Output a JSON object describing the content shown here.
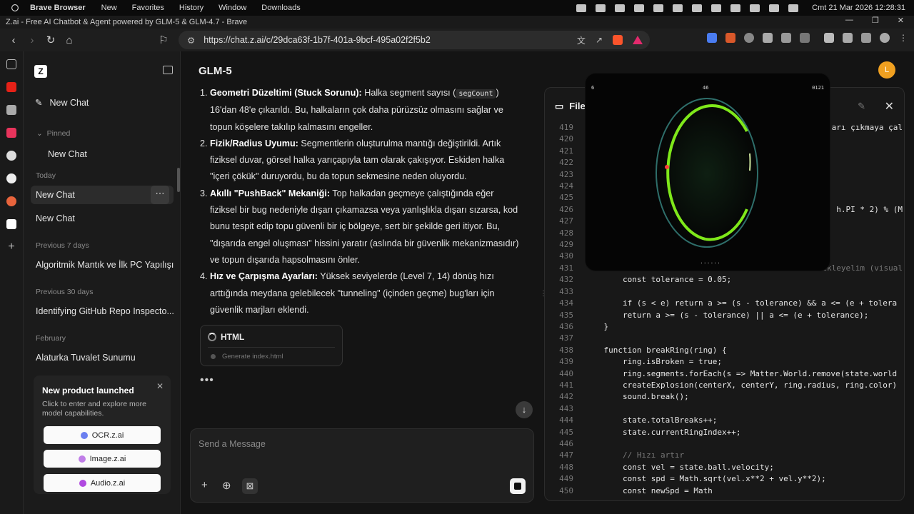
{
  "menubar": {
    "app": "Brave Browser",
    "items": [
      "New",
      "Favorites",
      "History",
      "Window",
      "Downloads"
    ],
    "clock": "Cmt 21 Mar 2026 12:28:31"
  },
  "window": {
    "title": "Z.ai - Free AI Chatbot & Agent powered by GLM-5 & GLM-4.7 - Brave"
  },
  "browser": {
    "url": "https://chat.z.ai/c/29dca63f-1b7f-401a-9bcf-495a02f2f5b2",
    "shield_count": "12"
  },
  "sidebar": {
    "new_chat": "New Chat",
    "pinned_label": "Pinned",
    "pinned_item": "New Chat",
    "today_label": "Today",
    "today_items": [
      "New Chat",
      "New Chat"
    ],
    "prev7_label": "Previous 7 days",
    "prev7_item": "Algoritmik Mantık ve İlk PC Yapılışı",
    "prev30_label": "Previous 30 days",
    "prev30_item": "Identifying GitHub Repo Inspecto...",
    "feb_label": "February",
    "feb_item": "Alaturka Tuvalet Sunumu",
    "promo": {
      "title": "New product launched",
      "desc": "Click to enter and explore more model capabilities.",
      "buttons": [
        "OCR.z.ai",
        "Image.z.ai",
        "Audio.z.ai"
      ]
    }
  },
  "chat": {
    "model": "GLM-5",
    "items": [
      {
        "title": "Geometri Düzeltimi (Stuck Sorunu):",
        "pre": " Halka segment sayısı (",
        "code": "segCount",
        "post": ") 16'dan 48'e çıkarıldı. Bu, halkaların çok daha pürüzsüz olmasını sağlar ve topun köşelere takılıp kalmasını engeller."
      },
      {
        "title": "Fizik/Radius Uyumu:",
        "text": " Segmentlerin oluşturulma mantığı değiştirildi. Artık fiziksel duvar, görsel halka yarıçapıyla tam olarak çakışıyor. Eskiden halka \"içeri çökük\" duruyordu, bu da topun sekmesine neden oluyordu."
      },
      {
        "title": "Akıllı \"PushBack\" Mekaniği:",
        "text": " Top halkadan geçmeye çalıştığında eğer fiziksel bir bug nedeniyle dışarı çıkamazsa veya yanlışlıkla dışarı sızarsa, kod bunu tespit edip topu güvenli bir iç bölgeye, sert bir şekilde geri itiyor. Bu, \"dışarıda engel oluşması\" hissini yaratır (aslında bir güvenlik mekanizmasıdır) ve topun dışarıda hapsolmasını önler."
      },
      {
        "title": "Hız ve Çarpışma Ayarları:",
        "text": " Yüksek seviyelerde (Level 7, 14) dönüş hızı arttığında meydana gelebilecek \"tunneling\" (içinden geçme) bug'ları için güvenlik marjları eklendi."
      }
    ],
    "artifact": {
      "title": "HTML",
      "step": "Generate index.html"
    },
    "composer_placeholder": "Send a Message",
    "avatar": "L"
  },
  "panel": {
    "title": "File"
  },
  "game": {
    "hud_left": "6",
    "hud_center": "46",
    "hud_right": "0121"
  },
  "code_lines": [
    {
      "n": 419,
      "t": ""
    },
    {
      "n": 420,
      "t": ""
    },
    {
      "n": 421,
      "t": ""
    },
    {
      "n": 422,
      "t": ""
    },
    {
      "n": 423,
      "t": ""
    },
    {
      "n": 424,
      "t": ""
    },
    {
      "n": 425,
      "t": ""
    },
    {
      "n": 426,
      "t": ""
    },
    {
      "n": 427,
      "t": ""
    },
    {
      "n": 428,
      "t": ""
    },
    {
      "n": 429,
      "t": ""
    },
    {
      "n": 430,
      "t": ""
    },
    {
      "n": 431,
      "t": ""
    },
    {
      "n": 432,
      "t": "        const tolerance = 0.05;"
    },
    {
      "n": 433,
      "t": ""
    },
    {
      "n": 434,
      "t": "        if (s < e) return a >= (s - tolerance) && a <= (e + tolera"
    },
    {
      "n": 435,
      "t": "        return a >= (s - tolerance) || a <= (e + tolerance);"
    },
    {
      "n": 436,
      "t": "    }"
    },
    {
      "n": 437,
      "t": ""
    },
    {
      "n": 438,
      "t": "    function breakRing(ring) {"
    },
    {
      "n": 439,
      "t": "        ring.isBroken = true;"
    },
    {
      "n": 440,
      "t": "        ring.segments.forEach(s => Matter.World.remove(state.world"
    },
    {
      "n": 441,
      "t": "        createExplosion(centerX, centerY, ring.radius, ring.color)"
    },
    {
      "n": 442,
      "t": "        sound.break();"
    },
    {
      "n": 443,
      "t": ""
    },
    {
      "n": 444,
      "t": "        state.totalBreaks++;"
    },
    {
      "n": 445,
      "t": "        state.currentRingIndex++;"
    },
    {
      "n": 446,
      "t": ""
    },
    {
      "n": 447,
      "t": "        // Hızı artır"
    },
    {
      "n": 448,
      "t": "        const vel = state.ball.velocity;"
    },
    {
      "n": 449,
      "t": "        const spd = Math.sqrt(vel.x**2 + vel.y**2);"
    },
    {
      "n": 450,
      "t": "        const newSpd = Math"
    }
  ],
  "code_fragments": {
    "l418": "arı çıkmaya çal",
    "l426": "h.PI * 2) % (M",
    "l431": "ekleyelim (visual"
  }
}
